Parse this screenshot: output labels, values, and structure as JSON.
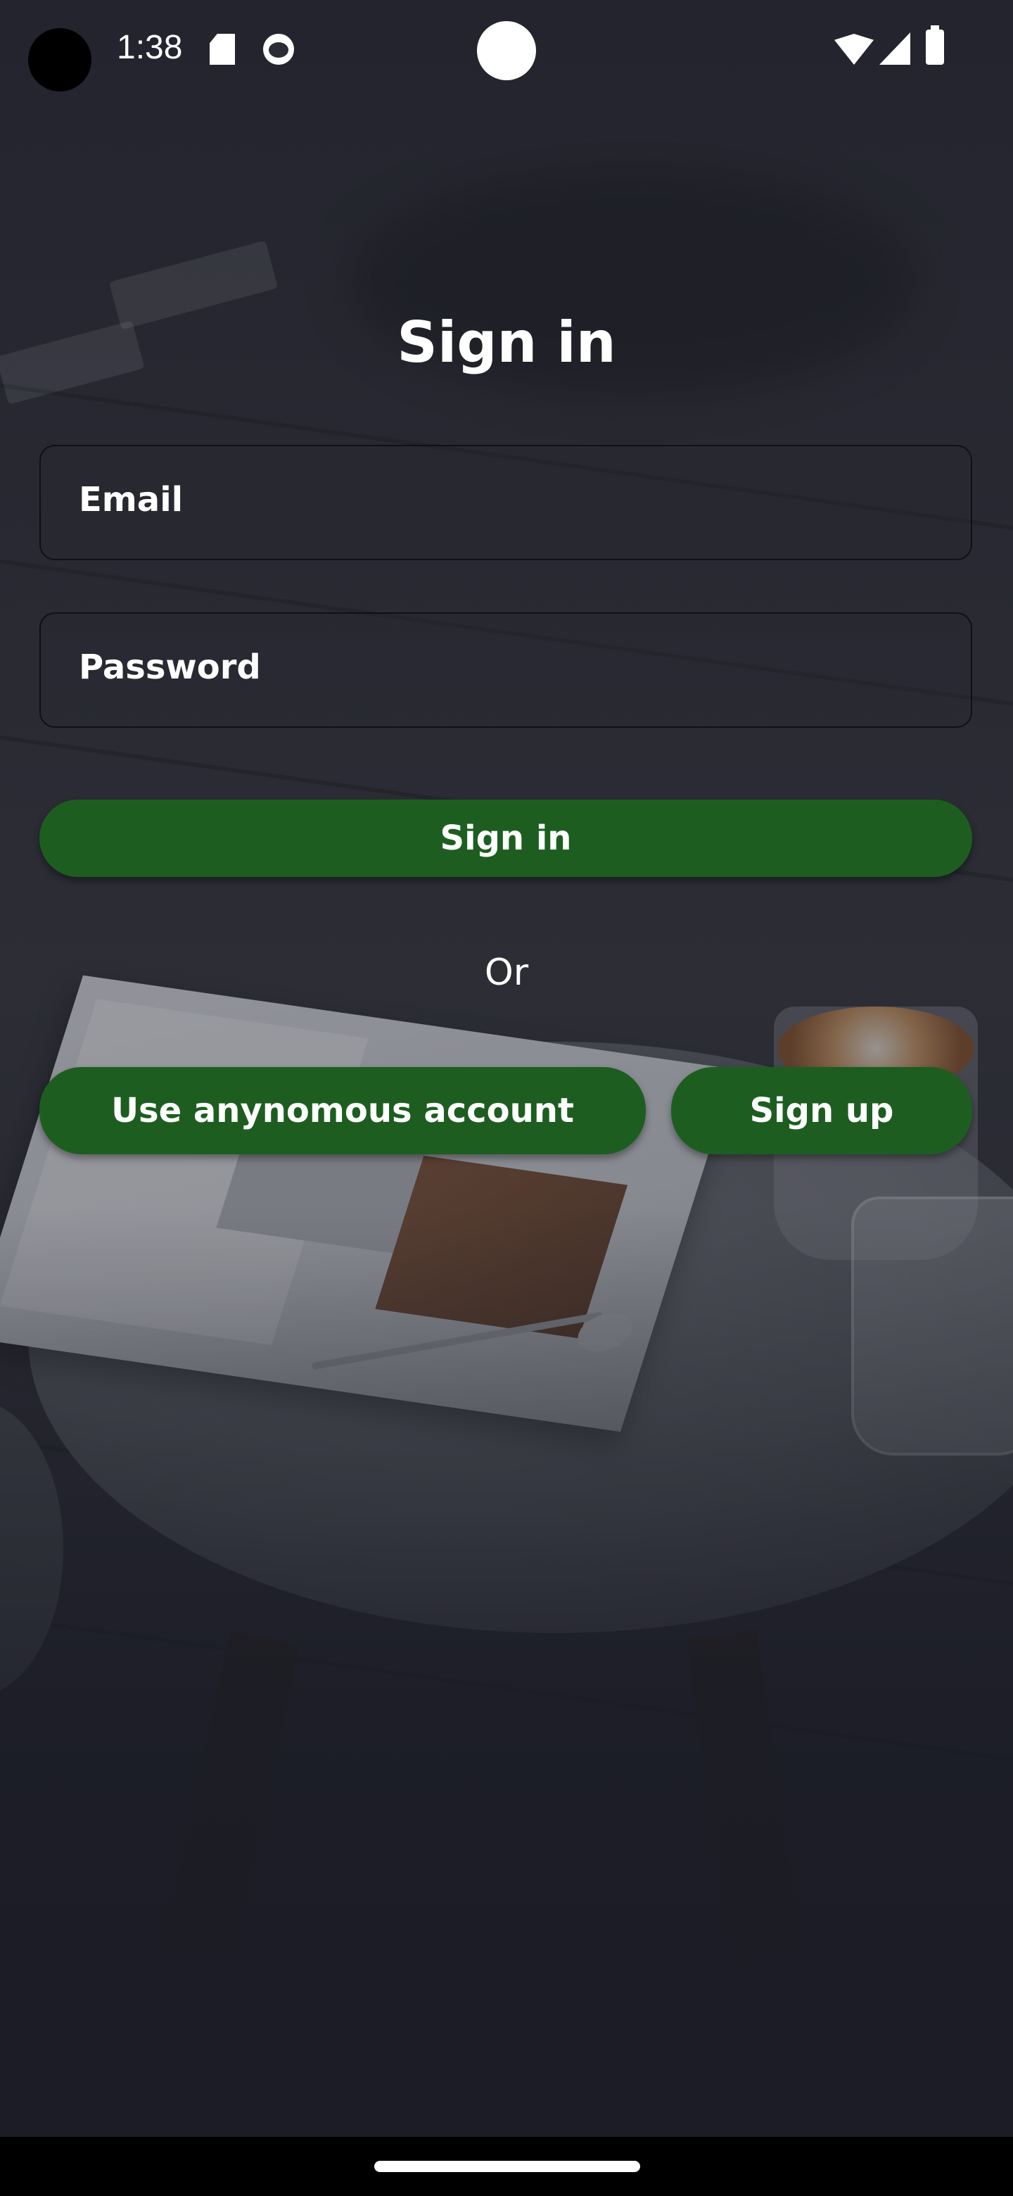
{
  "status_bar": {
    "time": "1:38",
    "icons": [
      "sd-card-icon",
      "face-icon",
      "wifi-icon",
      "signal-icon",
      "battery-icon"
    ]
  },
  "signin": {
    "title": "Sign in",
    "email_label": "Email",
    "password_label": "Password",
    "signin_button": "Sign in",
    "or_text": "Or",
    "anonymous_button": "Use anynomous account",
    "signup_button": "Sign up"
  },
  "colors": {
    "button_green": "#1d5e20",
    "background_dark": "#1b1c26"
  }
}
